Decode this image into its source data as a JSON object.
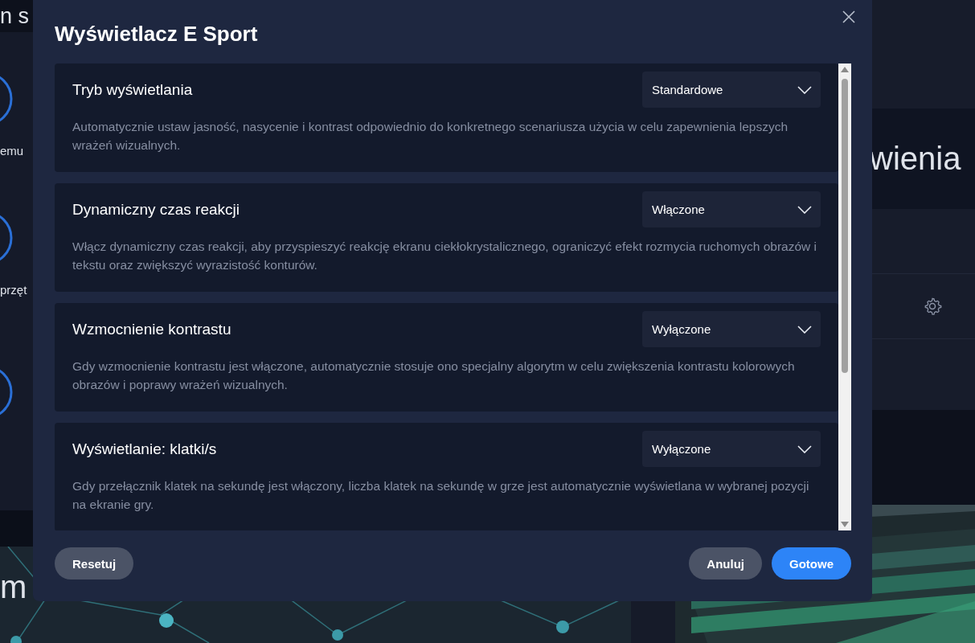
{
  "background": {
    "texts": [
      {
        "kind": "heading",
        "text": "n s"
      },
      {
        "kind": "label",
        "text": "emu"
      },
      {
        "kind": "label",
        "text": "przęt"
      },
      {
        "kind": "heading",
        "text": "m"
      },
      {
        "kind": "heading",
        "text": "wienia"
      }
    ]
  },
  "dialog": {
    "title": "Wyświetlacz E Sport",
    "settings": [
      {
        "title": "Tryb wyświetlania",
        "value": "Standardowe",
        "description": "Automatycznie ustaw jasność, nasycenie i kontrast odpowiednio do konkretnego scenariusza użycia w celu zapewnienia lepszych wrażeń wizualnych."
      },
      {
        "title": "Dynamiczny czas reakcji",
        "value": "Włączone",
        "description": "Włącz dynamiczny czas reakcji, aby przyspieszyć reakcję ekranu ciekłokrystalicznego, ograniczyć efekt rozmycia ruchomych obrazów i tekstu oraz zwiększyć wyrazistość konturów."
      },
      {
        "title": "Wzmocnienie kontrastu",
        "value": "Wyłączone",
        "description": "Gdy wzmocnienie kontrastu jest włączone, automatycznie stosuje ono specjalny algorytm w celu zwiększenia kontrastu kolorowych obrazów i poprawy wrażeń wizualnych."
      },
      {
        "title": "Wyświetlanie: klatki/s",
        "value": "Wyłączone",
        "description": "Gdy przełącznik klatek na sekundę jest włączony, liczba klatek na sekundę w grze jest automatycznie wyświetlana w wybranej pozycji na ekranie gry."
      }
    ],
    "buttons": [
      {
        "label": "Resetuj",
        "kind": "secondary"
      },
      {
        "label": "Anuluj",
        "kind": "secondary"
      },
      {
        "label": "Gotowe",
        "kind": "primary"
      }
    ]
  }
}
